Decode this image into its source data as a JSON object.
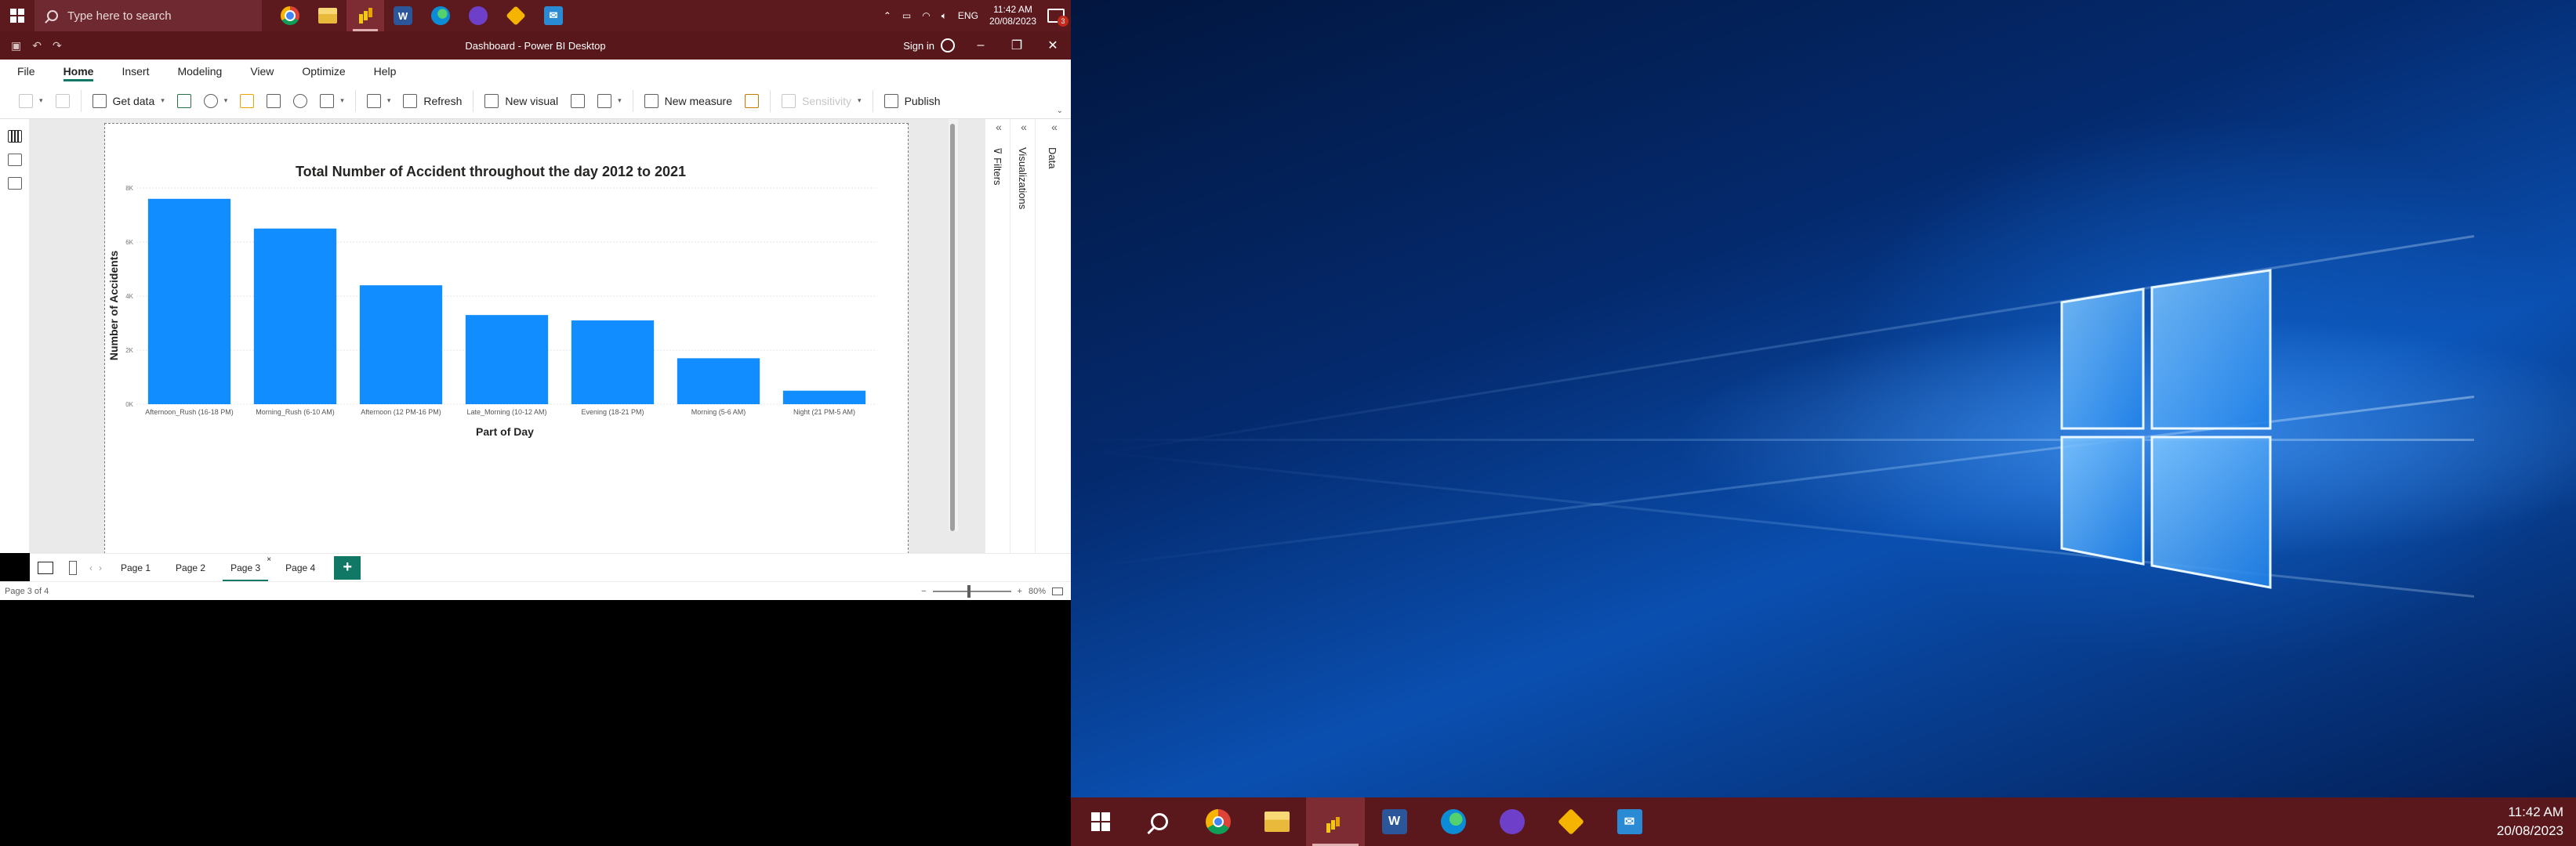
{
  "taskbar_top": {
    "search_placeholder": "Type here to search",
    "apps": [
      "chrome-icon",
      "file-explorer-icon",
      "power-bi-icon",
      "word-icon",
      "edge-icon",
      "github-desktop-icon",
      "git-icon",
      "mail-icon"
    ],
    "language": "ENG",
    "time": "11:42 AM",
    "date": "20/08/2023",
    "notification_count": "3"
  },
  "window": {
    "title": "Dashboard - Power BI Desktop",
    "sign_in": "Sign in",
    "minimize": "–",
    "maximize": "❐",
    "close": "✕"
  },
  "ribbon": {
    "tabs": [
      "File",
      "Home",
      "Insert",
      "Modeling",
      "View",
      "Optimize",
      "Help"
    ],
    "active_tab": "Home",
    "get_data": "Get data",
    "refresh": "Refresh",
    "new_visual": "New visual",
    "new_measure": "New measure",
    "sensitivity": "Sensitivity",
    "publish": "Publish"
  },
  "panes": {
    "filters": "Filters",
    "visualizations": "Visualizations",
    "data": "Data"
  },
  "chart_data": {
    "type": "bar",
    "title": "Total Number of Accident throughout the day 2012 to 2021",
    "xlabel": "Part of Day",
    "ylabel": "Number of Accidents",
    "categories": [
      "Afternoon_Rush (16-18 PM)",
      "Morning_Rush (6-10 AM)",
      "Afternoon (12 PM-16 PM)",
      "Late_Morning (10-12 AM)",
      "Evening (18-21 PM)",
      "Morning (5-6 AM)",
      "Night (21 PM-5 AM)"
    ],
    "values": [
      76,
      65,
      44,
      33,
      31,
      17,
      5
    ],
    "y_ticks": [
      "0K",
      "2K",
      "4K",
      "6K",
      "8K"
    ],
    "ylim": [
      0,
      80
    ],
    "grid": true,
    "bar_color": "#118DFF"
  },
  "pages": {
    "tabs": [
      "Page 1",
      "Page 2",
      "Page 3",
      "Page 4"
    ],
    "active": "Page 3",
    "add": "+"
  },
  "status": {
    "page_indicator": "Page 3 of 4",
    "zoom": "80%"
  },
  "taskbar_right": {
    "time": "11:42 AM",
    "date": "20/08/2023"
  }
}
